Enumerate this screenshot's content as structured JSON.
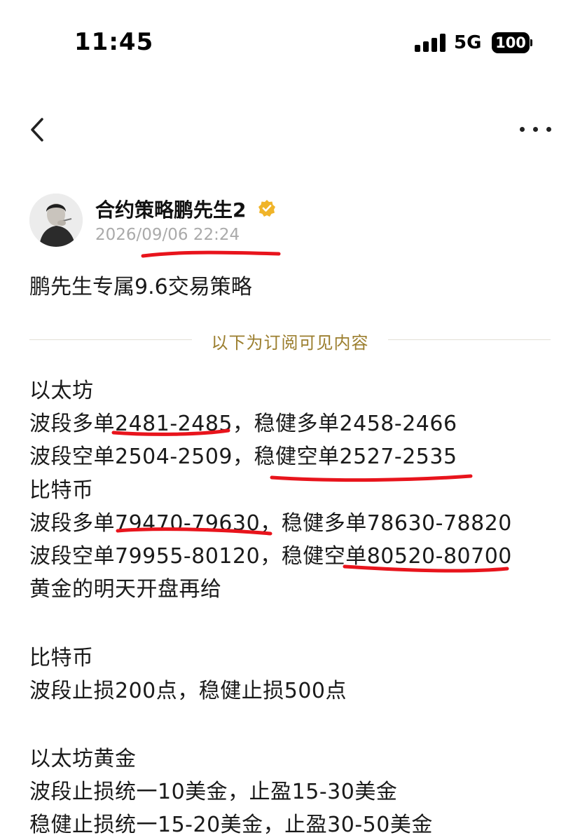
{
  "status_bar": {
    "time": "11:45",
    "network": "5G",
    "battery": "100",
    "icons": [
      "signal-bars-icon",
      "battery-icon"
    ]
  },
  "nav": {
    "icons": [
      "chevron-left-icon",
      "more-horizontal-icon"
    ]
  },
  "author": {
    "name": "合约策略鹏先生2",
    "time": "2026/09/06 22:24",
    "badge_icon": "verified-badge-icon",
    "badge_color": "#f0b429"
  },
  "post": {
    "title": "鹏先生专属9.6交易策略",
    "divider_label": "以下为订阅可见内容",
    "lines": [
      "以太坊",
      "波段多单2481-2485，稳健多单2458-2466",
      "波段空单2504-2509，稳健空单2527-2535",
      "比特币",
      "波段多单79470-79630，稳健多单78630-78820",
      "波段空单79955-80120，稳健空单80520-80700",
      "黄金的明天开盘再给",
      "比特币",
      "波段止损200点，稳健止损500点",
      "以太坊黄金",
      "波段止损统一10美金，止盈15-30美金",
      "稳健止损统一15-20美金，止盈30-50美金"
    ]
  },
  "colors": {
    "annotation": "#e8141c",
    "divider_text": "#9b7e2e",
    "timestamp": "#aaaaaa"
  }
}
